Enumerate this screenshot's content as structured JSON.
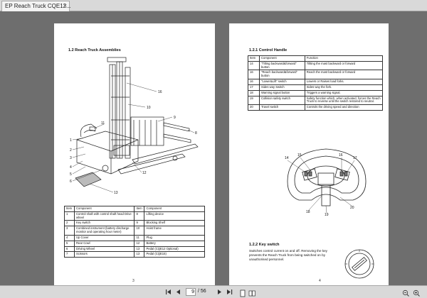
{
  "tab": {
    "title": "EP Reach Truck CQE12...",
    "close": "×"
  },
  "left_page": {
    "title": "1.2 Reach Truck Assemblies",
    "callouts": [
      "1",
      "2",
      "3",
      "4",
      "5",
      "6",
      "7",
      "8",
      "9",
      "10",
      "11",
      "12",
      "13",
      "14",
      "15",
      "16"
    ],
    "table": {
      "headers": [
        "Item",
        "Component",
        "Item",
        "Component"
      ],
      "rows": [
        [
          "1",
          "Control shaft with control shaft head Drive wheel",
          "8",
          "Lifting device"
        ],
        [
          "2",
          "Key switch",
          "9",
          "Blocking Shelf"
        ],
        [
          "3",
          "Combined instrument (battery discharge monitor and operating hour meter)",
          "10",
          "Hoist frame"
        ],
        [
          "4",
          "Up Cover",
          "11",
          "Plug"
        ],
        [
          "5",
          "Rear Cowl",
          "12",
          "Battery"
        ],
        [
          "6",
          "Driving Wheel",
          "13",
          "Pedal  (CQE12 Optional)"
        ],
        [
          "7",
          "Scissors",
          "13",
          "Pedal  (CQE15)"
        ]
      ]
    },
    "page_number": "3"
  },
  "right_page": {
    "title": "1.2.1 Control Handle",
    "table": {
      "headers": [
        "Item",
        "Component",
        "Function"
      ],
      "rows": [
        [
          "14",
          "\"Tilting backward&forward\" button",
          "Tiltting the mast backward or forward"
        ],
        [
          "16",
          "\"Reach backward&forward\" button",
          "Reach the mast backward or forward"
        ],
        [
          "16",
          "\"Lower&Lift\" switch",
          "Lowers or Raises load forks."
        ],
        [
          "17",
          "Sides way Switch",
          "Sides way the fork."
        ],
        [
          "18",
          "Warning signal button",
          "Triggers a warning signal."
        ],
        [
          "19",
          "Collision safety switch",
          "Safety function which, when activated, forces the Reach Truck to reverse until the switch restored to neutral."
        ],
        [
          "20",
          "Travel switch",
          "Controls the driving speed and direction"
        ]
      ]
    },
    "handle_callouts": [
      "14",
      "15",
      "16",
      "17",
      "18",
      "19",
      "20"
    ],
    "key_switch_title": "1.2.2 Key switch",
    "key_switch_text": "Switches control current on and off. Removing the key prevents the Reach Truck from being switched on by unauthorised personnel.",
    "page_number": "4"
  },
  "bottombar": {
    "current_page": "9",
    "total_pages": "/ 56"
  }
}
